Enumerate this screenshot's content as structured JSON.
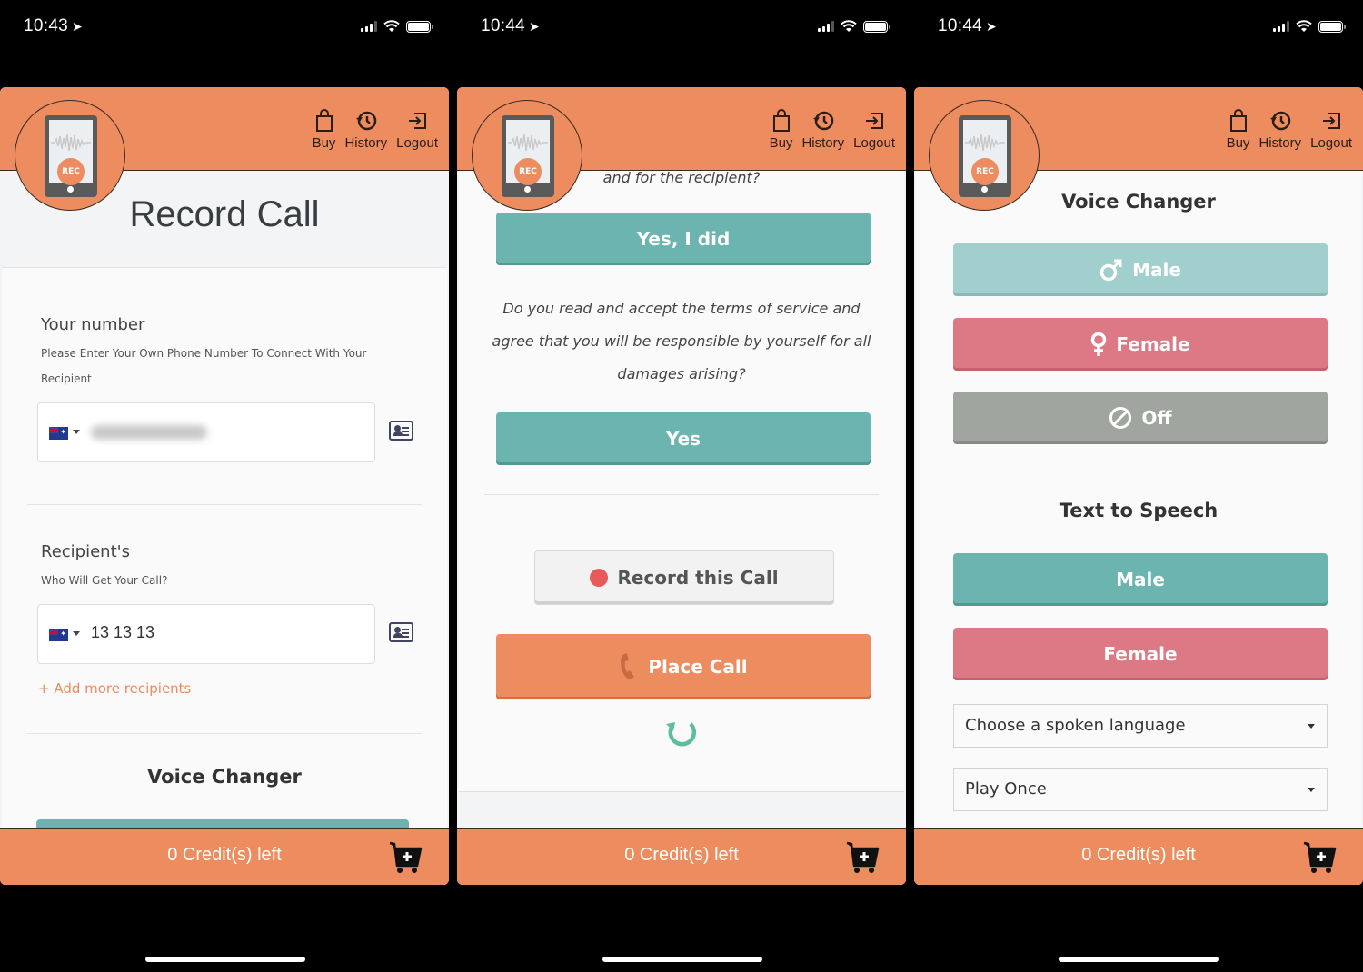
{
  "status_bars": [
    {
      "time": "10:43"
    },
    {
      "time": "10:44"
    },
    {
      "time": "10:44"
    }
  ],
  "nav": {
    "buy": "Buy",
    "history": "History",
    "logout": "Logout"
  },
  "logo": {
    "rec_label": "REC"
  },
  "footer": {
    "credits": "0 Credit(s) left"
  },
  "screen1": {
    "title": "Record Call",
    "your_number": {
      "label": "Your number",
      "hint": "Please Enter Your Own Phone Number To Connect With Your Recipient",
      "country": "AU",
      "value_blurred": true
    },
    "recipient": {
      "label": "Recipient's",
      "hint": "Who Will Get Your Call?",
      "country": "AU",
      "value": "13 13 13"
    },
    "add_more": "+ Add more recipients",
    "voice_changer_heading": "Voice Changer"
  },
  "screen2": {
    "question_partial": "and for the recipient?",
    "yes_i_did": "Yes, I did",
    "terms_question": "Do you read and accept the terms of service and agree that you will be responsible by yourself for all damages arising?",
    "yes": "Yes",
    "record_this_call": "Record this Call",
    "place_call": "Place Call"
  },
  "screen3": {
    "voice_changer_heading": "Voice Changer",
    "voice_male": "Male",
    "voice_female": "Female",
    "voice_off": "Off",
    "tts_heading": "Text to Speech",
    "tts_male": "Male",
    "tts_female": "Female",
    "language_select": "Choose a spoken language",
    "play_select": "Play Once"
  },
  "colors": {
    "brand_orange": "#ec8c5f",
    "teal": "#6bb4af",
    "teal_light": "#a1cfcd",
    "pink": "#dd7984",
    "gray": "#a1a5a0",
    "record_red": "#e85a5a"
  }
}
